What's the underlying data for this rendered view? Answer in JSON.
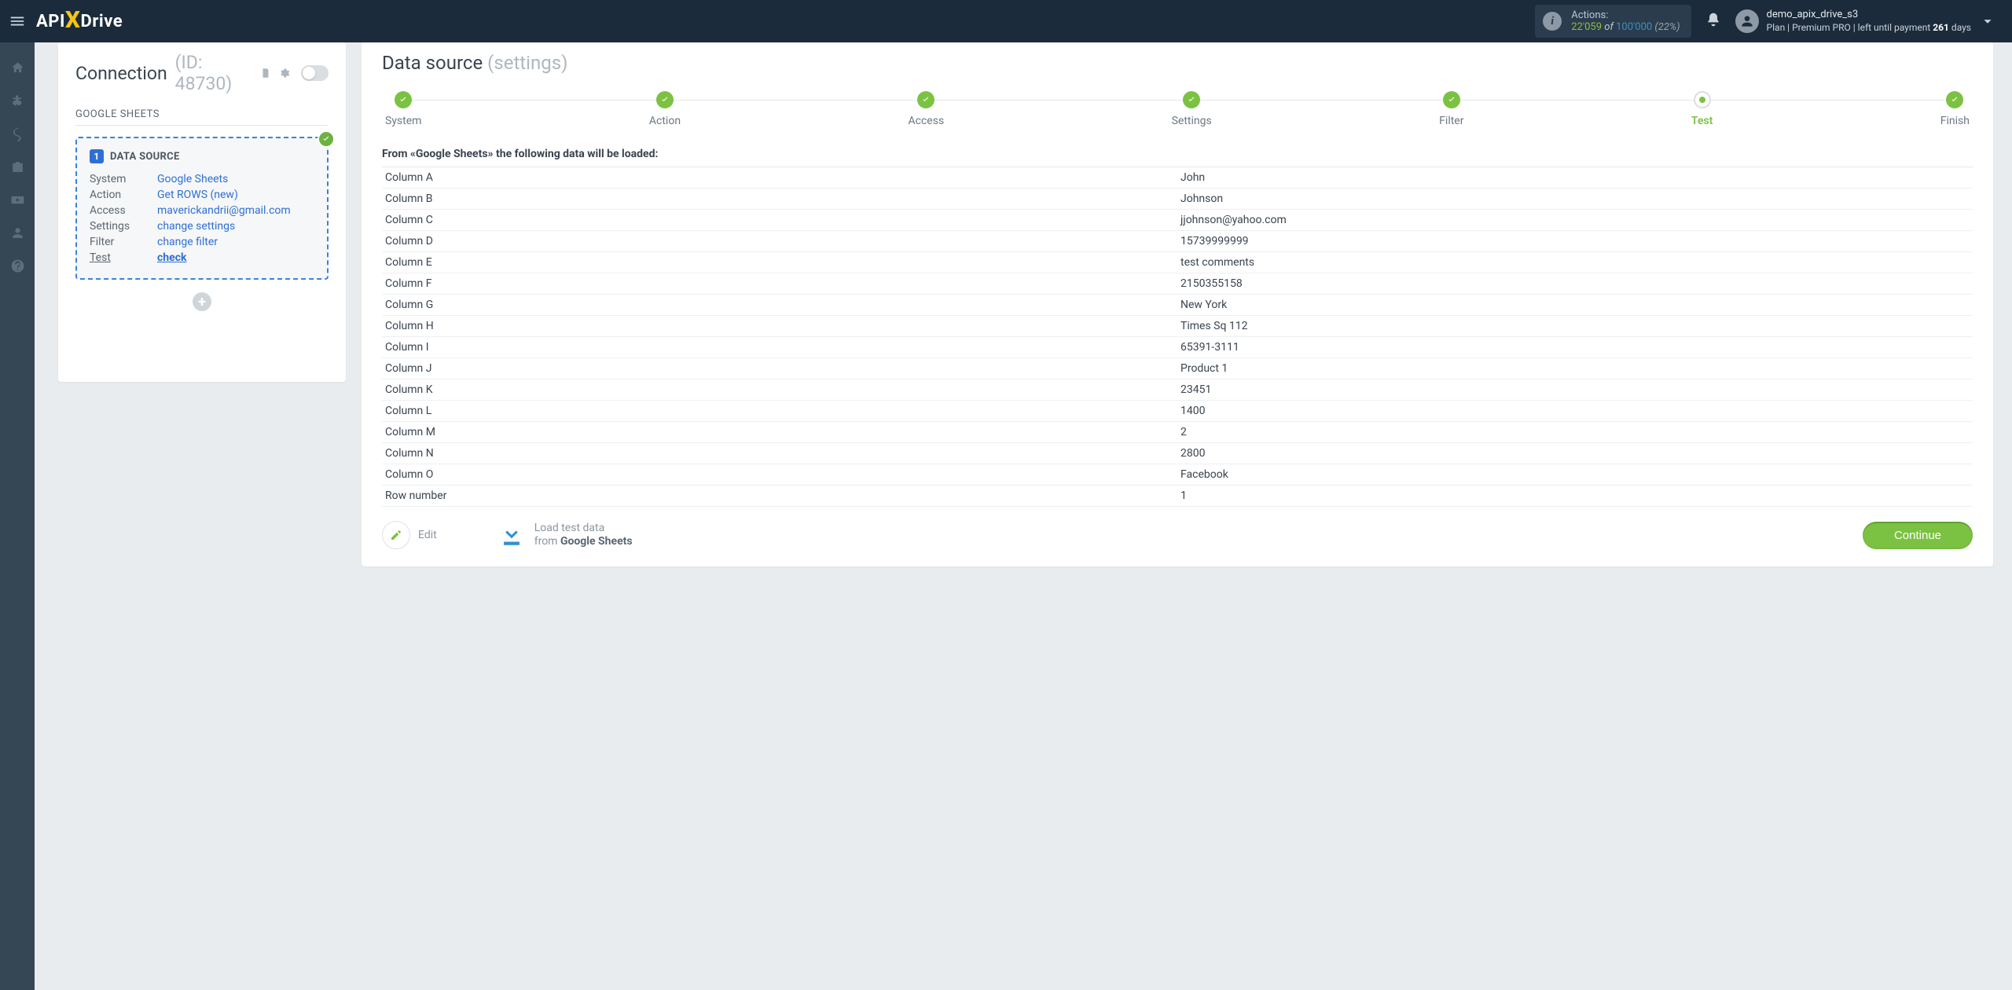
{
  "brand": {
    "prefix": "API",
    "x": "X",
    "suffix": "Drive"
  },
  "topbar": {
    "actions_label": "Actions:",
    "actions_used": "22'059",
    "actions_of": "of",
    "actions_total": "100'000",
    "actions_pct": "(22%)",
    "username": "demo_apix_drive_s3",
    "plan_prefix": "Plan |",
    "plan_name": "Premium PRO",
    "plan_mid": "| left until payment",
    "plan_days": "261",
    "plan_suffix": "days"
  },
  "left": {
    "title": "Connection",
    "id": "(ID: 48730)",
    "source_label": "GOOGLE SHEETS",
    "block_title": "DATA SOURCE",
    "rows": [
      {
        "k": "System",
        "v": "Google Sheets"
      },
      {
        "k": "Action",
        "v": "Get ROWS (new)"
      },
      {
        "k": "Access",
        "v": "maverickandrii@gmail.com"
      },
      {
        "k": "Settings",
        "v": "change settings"
      },
      {
        "k": "Filter",
        "v": "change filter"
      },
      {
        "k": "Test",
        "v": "check"
      }
    ],
    "badge": "1"
  },
  "right": {
    "title_main": "Data source",
    "title_grey": "(settings)",
    "steps": [
      {
        "label": "System",
        "state": "done"
      },
      {
        "label": "Action",
        "state": "done"
      },
      {
        "label": "Access",
        "state": "done"
      },
      {
        "label": "Settings",
        "state": "done"
      },
      {
        "label": "Filter",
        "state": "done"
      },
      {
        "label": "Test",
        "state": "current"
      },
      {
        "label": "Finish",
        "state": "done"
      }
    ],
    "from_line": "From «Google Sheets» the following data will be loaded:",
    "table": [
      {
        "c": "Column A",
        "v": "John"
      },
      {
        "c": "Column B",
        "v": "Johnson"
      },
      {
        "c": "Column C",
        "v": "jjohnson@yahoo.com"
      },
      {
        "c": "Column D",
        "v": "15739999999"
      },
      {
        "c": "Column E",
        "v": "test comments"
      },
      {
        "c": "Column F",
        "v": "2150355158"
      },
      {
        "c": "Column G",
        "v": "New York"
      },
      {
        "c": "Column H",
        "v": "Times Sq 112"
      },
      {
        "c": "Column I",
        "v": "65391-3111"
      },
      {
        "c": "Column J",
        "v": "Product 1"
      },
      {
        "c": "Column K",
        "v": "23451"
      },
      {
        "c": "Column L",
        "v": "1400"
      },
      {
        "c": "Column M",
        "v": "2"
      },
      {
        "c": "Column N",
        "v": "2800"
      },
      {
        "c": "Column O",
        "v": "Facebook"
      },
      {
        "c": "Row number",
        "v": "1"
      }
    ],
    "edit_label": "Edit",
    "load_line1": "Load test data",
    "load_line2_from": "from",
    "load_line2_src": "Google Sheets",
    "continue_label": "Continue"
  }
}
